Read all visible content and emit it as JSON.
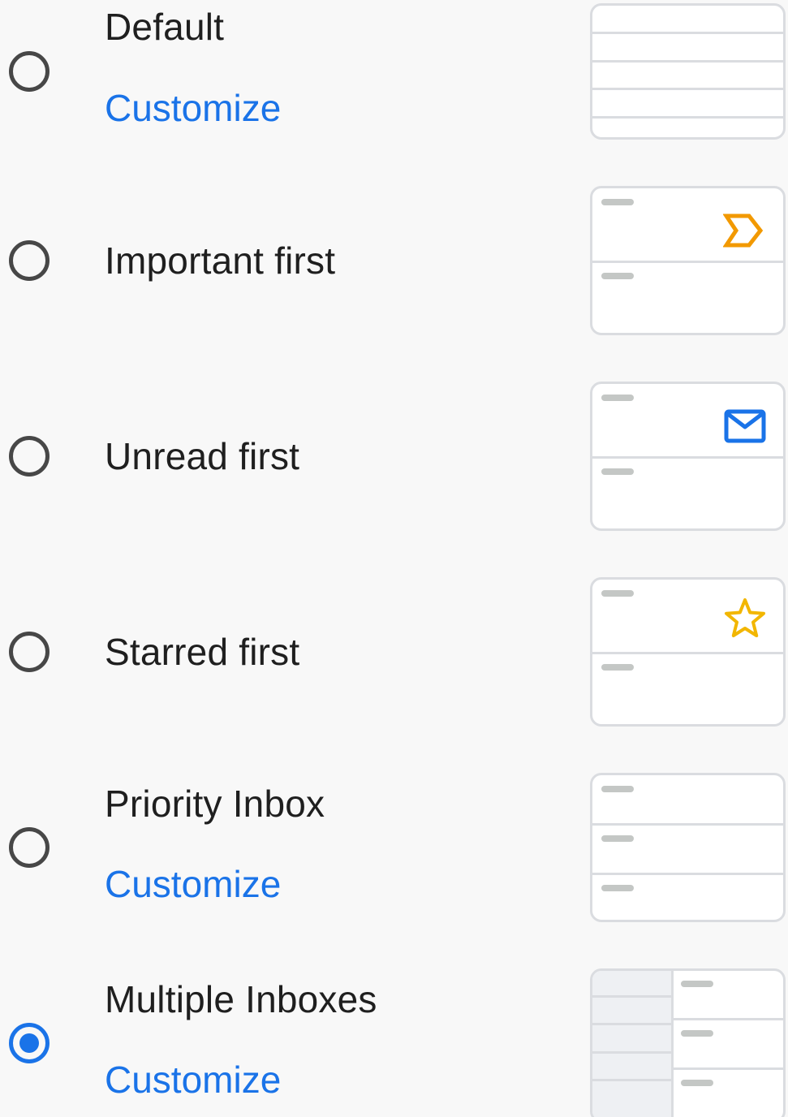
{
  "options": [
    {
      "label": "Default",
      "customize": "Customize",
      "selected": false,
      "preview_icon": "none"
    },
    {
      "label": "Important first",
      "customize": null,
      "selected": false,
      "preview_icon": "important-marker-icon"
    },
    {
      "label": "Unread first",
      "customize": null,
      "selected": false,
      "preview_icon": "envelope-icon"
    },
    {
      "label": "Starred first",
      "customize": null,
      "selected": false,
      "preview_icon": "star-outline-icon"
    },
    {
      "label": "Priority Inbox",
      "customize": "Customize",
      "selected": false,
      "preview_icon": "none"
    },
    {
      "label": "Multiple Inboxes",
      "customize": "Customize",
      "selected": true,
      "preview_icon": "none"
    }
  ],
  "colors": {
    "accent": "#1a73e8",
    "radio_unchecked": "#474747",
    "important": "#f29900",
    "star": "#f2b600",
    "envelope": "#1a73e8",
    "preview_border": "#dadce0"
  }
}
